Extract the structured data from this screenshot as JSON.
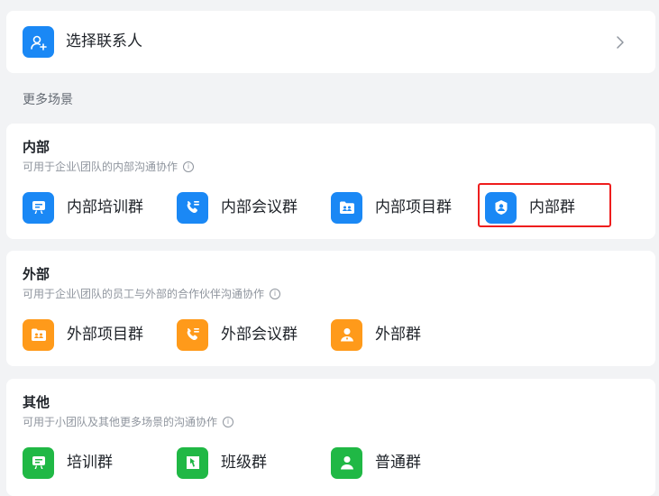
{
  "contact": {
    "label": "选择联系人"
  },
  "more_scenes_label": "更多场景",
  "sections": {
    "internal": {
      "title": "内部",
      "desc": "可用于企业\\团队的内部沟通协作",
      "items": [
        "内部培训群",
        "内部会议群",
        "内部项目群",
        "内部群"
      ]
    },
    "external": {
      "title": "外部",
      "desc": "可用于企业\\团队的员工与外部的合作伙伴沟通协作",
      "items": [
        "外部项目群",
        "外部会议群",
        "外部群"
      ]
    },
    "other": {
      "title": "其他",
      "desc": "可用于小团队及其他更多场景的沟通协作",
      "items": [
        "培训群",
        "班级群",
        "普通群"
      ]
    }
  },
  "info_glyph": "i",
  "colors": {
    "blue": "#1a88f5",
    "orange": "#ff9a1a",
    "green": "#20b845",
    "highlight": "#ee1d1d"
  }
}
